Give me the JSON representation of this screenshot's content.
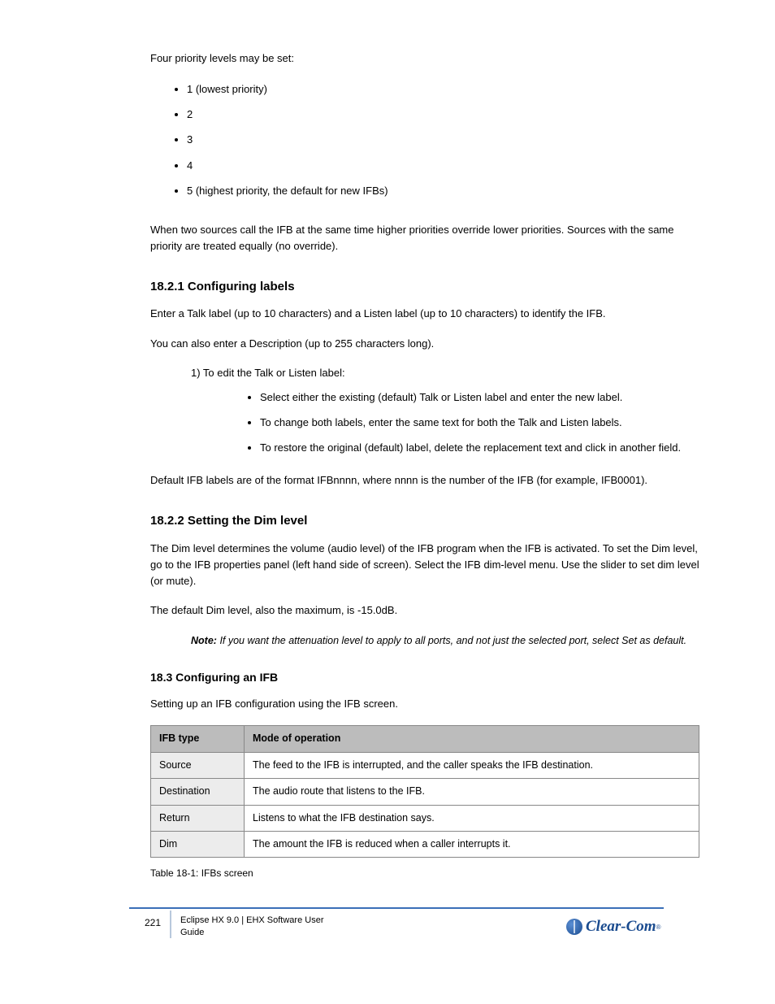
{
  "intro": "Four priority levels may be set:",
  "priority_levels": [
    "1 (lowest priority)",
    "2",
    "3",
    "4",
    "5 (highest priority, the default for new IFBs)"
  ],
  "para_priorities": "When two sources call the IFB at the same time higher priorities override lower priorities. Sources with the same priority are treated equally (no override).",
  "h_labels": "18.2.1 Configuring labels",
  "labels_p1": "Enter a Talk label (up to 10 characters) and a Listen label (up to 10 characters) to identify the IFB.",
  "labels_p2": "You can also enter a Description (up to 255 characters long).",
  "labels_step_head": "1) To edit the Talk or Listen label:",
  "labels_step_items": [
    "Select either the existing (default) Talk or Listen label and enter the new label.",
    "To change both labels, enter the same text for both the Talk and Listen labels.",
    "To restore the original (default) label, delete the replacement text and click in another field."
  ],
  "labels_p3": "Default IFB labels are of the format IFBnnnn, where nnnn is the number of the IFB (for example, IFB0001).",
  "h_dim": "18.2.2 Setting the Dim level",
  "dim_p1": "The Dim level determines the volume (audio level) of the IFB program when the IFB is activated. To set the Dim level, go to the IFB properties panel (left hand side of screen). Select the IFB dim-level menu. Use the slider to set dim level (or mute).",
  "dim_p2": "The default Dim level, also the maximum, is -15.0dB.",
  "note_label": "Note:",
  "note_text": "If you want the attenuation level to apply to all ports, and not just the selected port, select Set as default.",
  "h_cfg": "18.3 Configuring an IFB",
  "cfg_p1": "Setting up an IFB configuration using the IFB screen.",
  "table_header": [
    "IFB type",
    "Mode of operation"
  ],
  "table_rows": [
    [
      "Source",
      "The feed to the IFB is interrupted, and the caller speaks the IFB destination."
    ],
    [
      "Destination",
      "The audio route that listens to the IFB."
    ],
    [
      "Return",
      "Listens to what the IFB destination says."
    ],
    [
      "Dim",
      "The amount the IFB is reduced when a caller interrupts it."
    ]
  ],
  "table_caption": "Table 18-1: IFBs screen",
  "footer_page": "221",
  "footer_title_l1": "Eclipse HX 9.0 | EHX Software User",
  "footer_title_l2": "Guide",
  "logo_text": "Clear-Com"
}
